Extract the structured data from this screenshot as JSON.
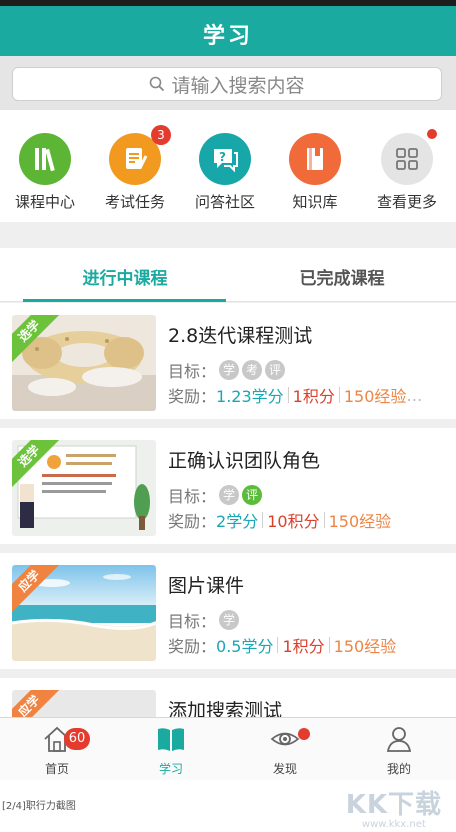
{
  "header": {
    "title": "学习"
  },
  "search": {
    "placeholder": "请输入搜索内容"
  },
  "shortcuts": [
    {
      "label": "课程中心",
      "icon": "books-icon",
      "color": "#5cb535"
    },
    {
      "label": "考试任务",
      "icon": "exam-paper-icon",
      "color": "#f29a1f",
      "badge": "3"
    },
    {
      "label": "问答社区",
      "icon": "question-chat-icon",
      "color": "#18a7a9"
    },
    {
      "label": "知识库",
      "icon": "book-icon",
      "color": "#f06a3a"
    },
    {
      "label": "查看更多",
      "icon": "grid-icon",
      "color": "#e4e4e4",
      "dot": true
    }
  ],
  "tabs": [
    {
      "label": "进行中课程",
      "active": true
    },
    {
      "label": "已完成课程",
      "active": false
    }
  ],
  "courses": [
    {
      "tag": "选学",
      "tag_color": "#6cc33b",
      "title": "2.8迭代课程测试",
      "goal_label": "目标：",
      "goals": [
        {
          "text": "学",
          "done": false
        },
        {
          "text": "考",
          "done": false
        },
        {
          "text": "评",
          "done": false
        }
      ],
      "reward_label": "奖励：",
      "credits": "1.23学分",
      "points": "1积分",
      "exp": "150经验",
      "more": "…"
    },
    {
      "tag": "选学",
      "tag_color": "#6cc33b",
      "title": "正确认识团队角色",
      "goal_label": "目标：",
      "goals": [
        {
          "text": "学",
          "done": false
        },
        {
          "text": "评",
          "done": true
        }
      ],
      "reward_label": "奖励：",
      "credits": "2学分",
      "points": "10积分",
      "exp": "150经验"
    },
    {
      "tag": "应学",
      "tag_color": "#f08340",
      "title": "图片课件",
      "goal_label": "目标：",
      "goals": [
        {
          "text": "学",
          "done": false
        }
      ],
      "reward_label": "奖励：",
      "credits": "0.5学分",
      "points": "1积分",
      "exp": "150经验"
    },
    {
      "tag": "应学",
      "tag_color": "#f08340",
      "title": "添加搜索测试"
    }
  ],
  "bottom_nav": [
    {
      "label": "首页",
      "icon": "home-icon",
      "badge": "60"
    },
    {
      "label": "学习",
      "icon": "open-book-icon",
      "active": true
    },
    {
      "label": "发现",
      "icon": "eye-icon",
      "dot": true
    },
    {
      "label": "我的",
      "icon": "user-icon"
    }
  ],
  "footer": {
    "caption": "[2/4]职行力截图",
    "watermark": "KK下载",
    "watermark_url": "www.kkx.net"
  }
}
